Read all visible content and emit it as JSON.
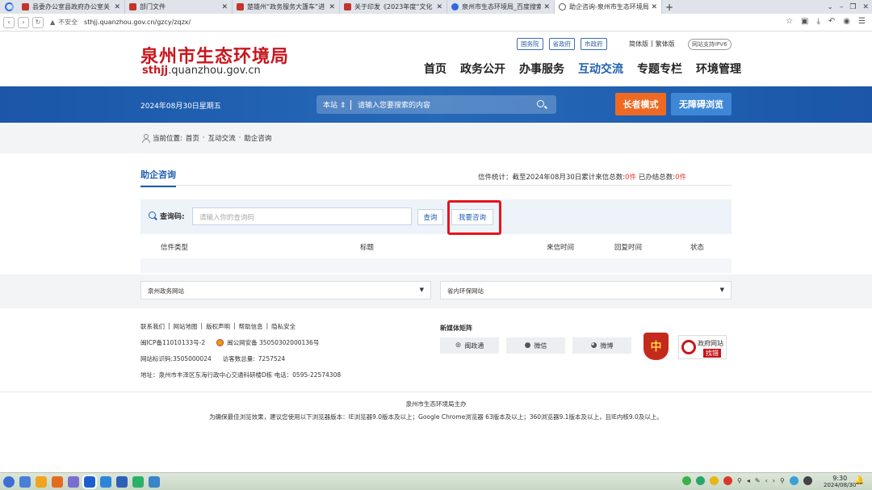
{
  "browser": {
    "tabs": [
      {
        "title": "县委办公室县政府办公室关",
        "favicon": "red"
      },
      {
        "title": "部门文件",
        "favicon": "red"
      },
      {
        "title": "楚雄州“政务服务大篷车”进",
        "favicon": "red"
      },
      {
        "title": "关于印发《2023年度“文化",
        "favicon": "red"
      },
      {
        "title": "泉州市生态环境局_百度搜索",
        "favicon": "blue"
      },
      {
        "title": "助企咨询-泉州市生态环境局",
        "favicon": "globe"
      }
    ],
    "insecure_label": "不安全",
    "url": "sthjj.quanzhou.gov.cn/gzcy/zqzx/"
  },
  "site": {
    "name_cn": "泉州市生态环境局",
    "domain_prefix": "sthjj",
    "domain_suffix": ".quanzhou.gov.cn",
    "top_links": [
      "国务院",
      "省政府",
      "市政府"
    ],
    "lang_simplified": "简体版",
    "lang_sep": "|",
    "lang_traditional": "繁体版",
    "ipv6": "网站支持IPV6",
    "nav": [
      "首页",
      "政务公开",
      "办事服务",
      "互动交流",
      "专题专栏",
      "环境管理"
    ],
    "nav_active_index": 3,
    "date": "2024年08月30日星期五",
    "search_scope": "本站",
    "search_placeholder": "请输入您要搜索的内容",
    "elder_mode": "长者模式",
    "accessible": "无障碍浏览"
  },
  "breadcrumb": {
    "label": "当前位置:",
    "items": [
      "首页",
      "互动交流",
      "助企咨询"
    ]
  },
  "consult": {
    "title": "助企咨询",
    "stats_prefix": "信件统计：截至2024年08月30日累计来信总数:",
    "total": "0件",
    "done_prefix": "已办结总数:",
    "done": "0件",
    "query_label": "查询码:",
    "query_placeholder": "请输入你的查询码",
    "query_button": "查询",
    "ask_button": "我要咨询",
    "columns": [
      "信件类型",
      "标题",
      "来信时间",
      "回复时间",
      "状态"
    ]
  },
  "selects": {
    "left": "泉州政务网站",
    "right": "省内环保网站"
  },
  "footer": {
    "links": [
      "联系我们",
      "网站地图",
      "版权声明",
      "帮助信息",
      "隐私安全"
    ],
    "icp": "闽ICP备11010133号-2",
    "police": "闽公网安备 35050302000136号",
    "site_code": "网站标识码:3505000024",
    "visits_label": "访客数总量:",
    "visits": "7257524",
    "address": "地址：泉州市丰泽区东海行政中心交通科研楼D栋 电话：0595-22574308",
    "media_title": "新媒体矩阵",
    "media": [
      "闽政通",
      "微信",
      "微博"
    ],
    "gov_badge_line1": "政府网站",
    "gov_badge_line2": "找错",
    "sponsor": "泉州市生态环境局主办",
    "browser_note": "为确保最佳浏览效果，建议您使用以下浏览器版本：IE浏览器9.0版本及以上；Google Chrome浏览器 63版本及以上；360浏览器9.1版本及以上，且IE内核9.0及以上。"
  },
  "taskbar": {
    "time": "9:30",
    "date": "2024/08/30"
  }
}
